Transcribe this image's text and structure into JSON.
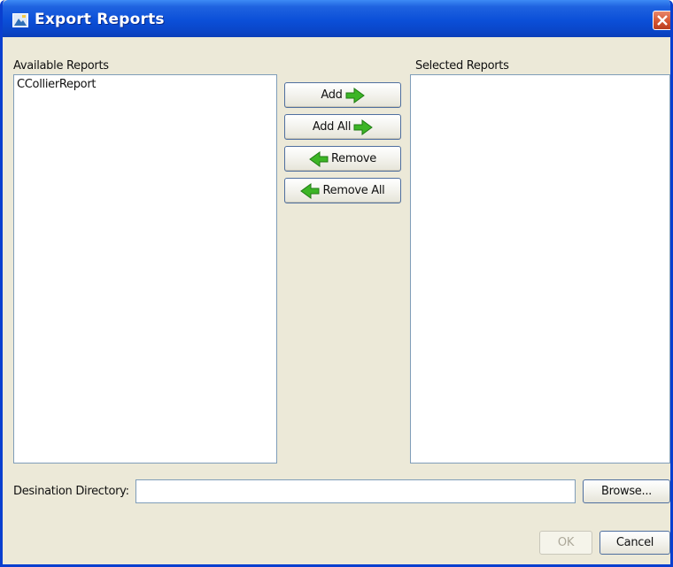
{
  "window": {
    "title": "Export Reports"
  },
  "available": {
    "label": "Available Reports",
    "items": [
      "CCollierReport"
    ]
  },
  "selected": {
    "label": "Selected Reports",
    "items": []
  },
  "buttons": {
    "add": "Add",
    "add_all": "Add All",
    "remove": "Remove",
    "remove_all": "Remove All"
  },
  "destination": {
    "label": "Desination Directory:",
    "value": "",
    "browse": "Browse..."
  },
  "dialog": {
    "ok": "OK",
    "cancel": "Cancel"
  },
  "colors": {
    "arrow_green": "#3cb526",
    "titlebar_blue": "#0b4fd8",
    "dialog_bg": "#ece9d8"
  }
}
